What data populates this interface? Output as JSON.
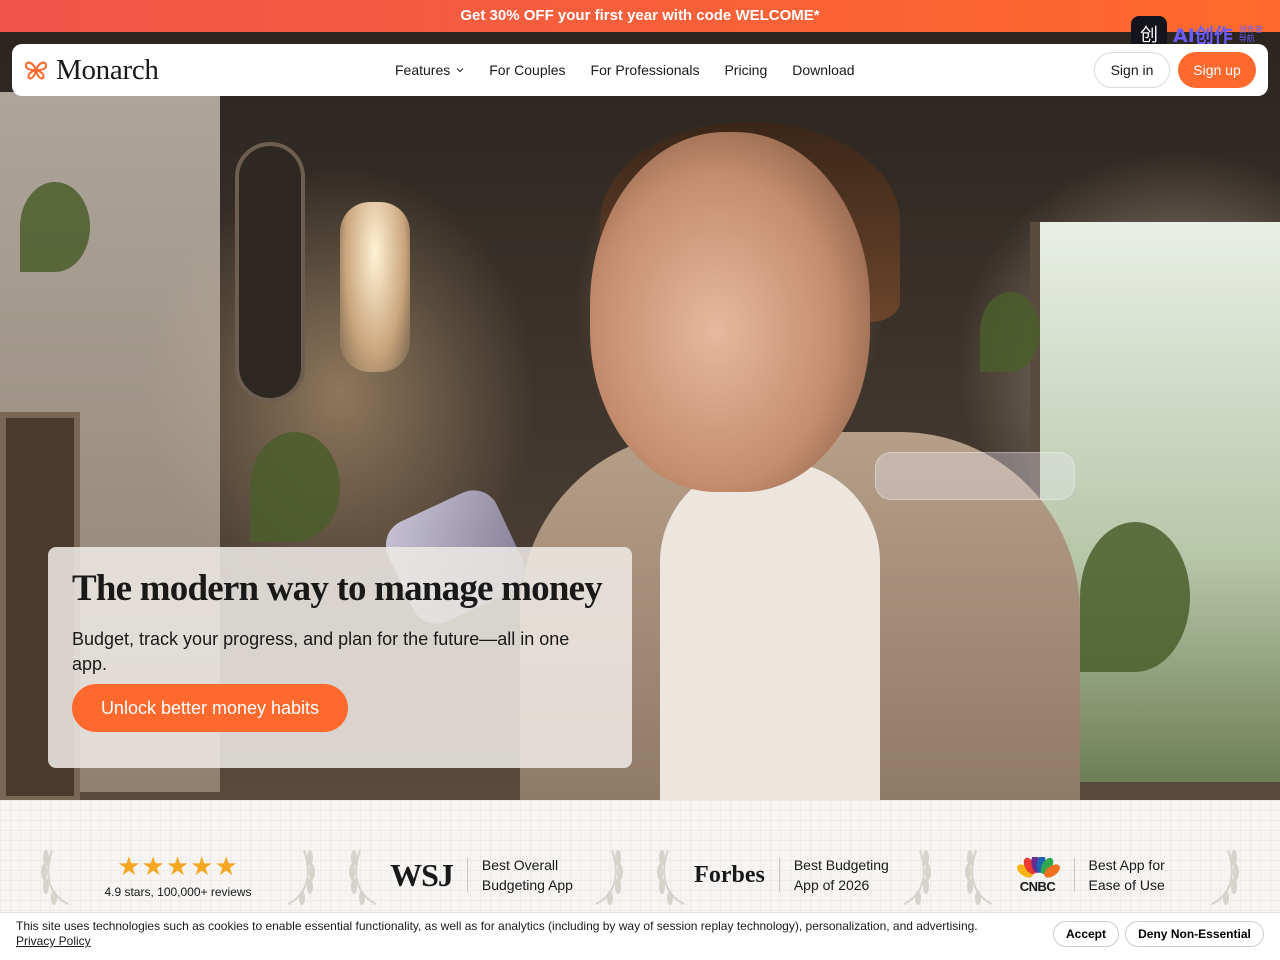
{
  "promo": {
    "text": "Get 30% OFF your first year with code WELCOME*"
  },
  "watermark": {
    "icon": "创",
    "text": "AI创作",
    "small_top": "创作者",
    "small_bottom": "导航"
  },
  "nav": {
    "logo_text": "Monarch",
    "links": [
      {
        "label": "Features",
        "has_dropdown": true
      },
      {
        "label": "For Couples"
      },
      {
        "label": "For Professionals"
      },
      {
        "label": "Pricing"
      },
      {
        "label": "Download"
      }
    ],
    "signin_label": "Sign in",
    "signup_label": "Sign up"
  },
  "hero": {
    "title": "The modern way to manage money",
    "subtitle": "Budget, track your progress, and plan for the future—all in one app.",
    "cta_label": "Unlock better money habits"
  },
  "awards": [
    {
      "type": "rating",
      "stars": 5,
      "text": "4.9 stars, 100,000+ reviews"
    },
    {
      "type": "press",
      "publication": "WSJ",
      "line1": "Best Overall",
      "line2": "Budgeting App"
    },
    {
      "type": "press",
      "publication": "Forbes",
      "line1": "Best Budgeting",
      "line2": "App of 2026"
    },
    {
      "type": "press",
      "publication": "CNBC",
      "line1": "Best App for",
      "line2": "Ease of Use"
    }
  ],
  "cookie": {
    "text": "This site uses technologies such as cookies to enable essential functionality, as well as for analytics (including by way of session replay technology), personalization, and advertising.",
    "link_label": "Privacy Policy",
    "accept_label": "Accept",
    "deny_label": "Deny Non-Essential"
  },
  "colors": {
    "accent": "#ff692d",
    "promo_start": "#f0544a",
    "promo_end": "#ff6a2b",
    "star": "#f5a623"
  }
}
